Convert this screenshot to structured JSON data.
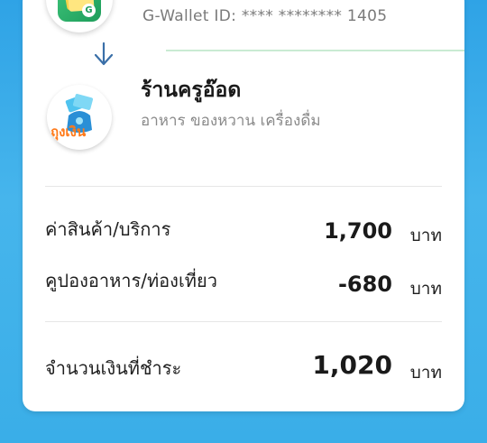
{
  "wallet": {
    "id_text": "G-Wallet ID: **** ******** 1405",
    "icon": "g-wallet-app-icon",
    "badge": "G"
  },
  "merchant": {
    "name": "ร้านครูอ๊อด",
    "category": "อาหาร ของหวาน เครื่องดื่ม",
    "icon": "tung-ngern-logo",
    "logo_text": "ถุงเงิน"
  },
  "rows": [
    {
      "label": "ค่าสินค้า/บริการ",
      "amount": "1,700",
      "unit": "บาท"
    },
    {
      "label": "คูปองอาหาร/ท่องเที่ยว",
      "amount": "-680",
      "unit": "บาท"
    }
  ],
  "total": {
    "label": "จำนวนเงินที่ชำระ",
    "amount": "1,020",
    "unit": "บาท"
  },
  "colors": {
    "background": "#3aaee8",
    "card": "#ffffff",
    "accent_green": "#1d9d5a",
    "arrow": "#3a6fa8"
  }
}
